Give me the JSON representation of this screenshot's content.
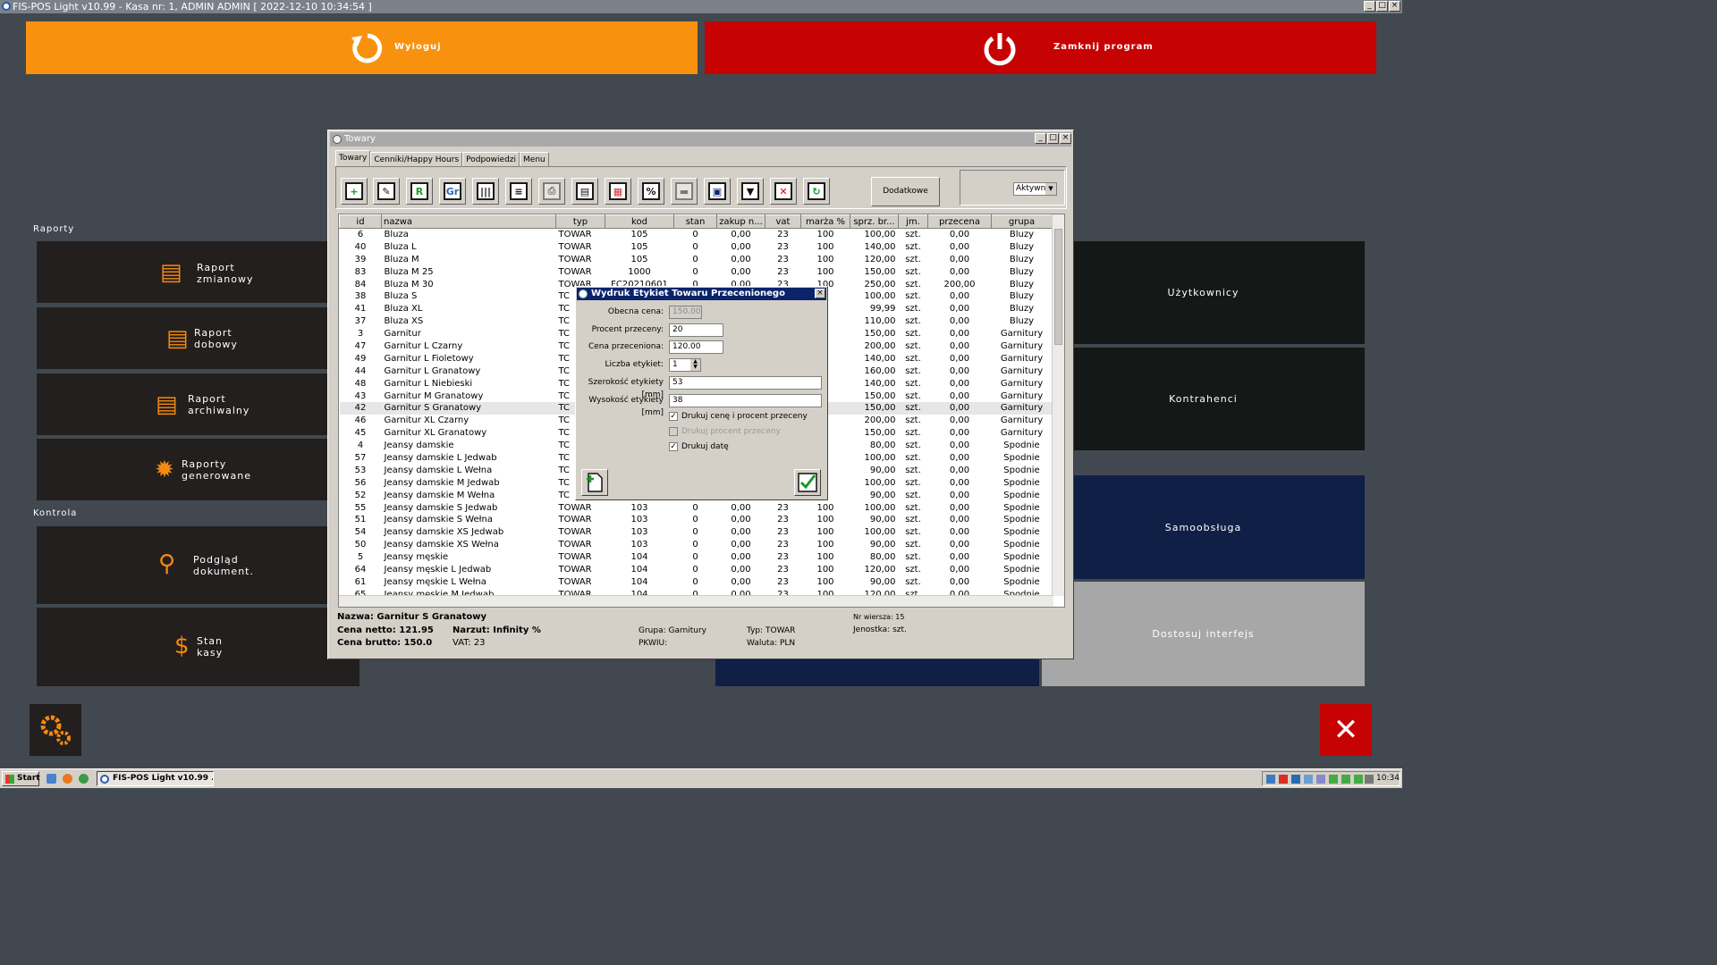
{
  "app": {
    "title": "FIS-POS Light v10.99 - Kasa nr: 1, ADMIN ADMIN [ 2022-12-10 10:34:54 ]"
  },
  "top_buttons": {
    "logout_label": "Wyloguj",
    "close_label": "Zamknij program"
  },
  "colors": {
    "logout": "#f8920e",
    "close": "#c60202",
    "tile_dark": "#231f1e",
    "samoobsluga": "#0f1f45"
  },
  "left_panel": {
    "section_reports": "Raporty",
    "section_control": "Kontrola",
    "tiles": [
      {
        "line1": "Raport",
        "line2": "zmianowy",
        "icon": "report-icon"
      },
      {
        "line1": "Raport",
        "line2": "dobowy",
        "icon": "report-icon"
      },
      {
        "line1": "Raport",
        "line2": "archiwalny",
        "icon": "report-icon"
      },
      {
        "line1": "Raporty",
        "line2": "generowane",
        "icon": "gear-icon"
      },
      {
        "line1": "Podgląd",
        "line2": "dokument.",
        "icon": "magnifier-icon"
      },
      {
        "line1": "Stan",
        "line2": "kasy",
        "icon": "dollar-icon"
      }
    ]
  },
  "right_panel": {
    "users": "Użytkownicy",
    "contractors": "Kontrahenci",
    "self_service": "Samoobsługa",
    "customize": "Dostosuj interfejs"
  },
  "window": {
    "title": "Towary",
    "tabs": [
      "Towary",
      "Cenniki/Happy Hours",
      "Podpowiedzi",
      "Menu"
    ],
    "extra_options": "Dodatkowe opcje",
    "filter_value": "Aktywne",
    "toolbar_icons": [
      "new-item-icon",
      "edit-icon",
      "r-icon",
      "gr-icon",
      "barcode-icon",
      "list-settings-icon",
      "printer-icon",
      "label-print-icon",
      "goods-icon",
      "percent-icon",
      "truck-icon",
      "save-icon",
      "filter-icon",
      "clear-filter-icon",
      "refresh-icon"
    ],
    "columns": [
      "id",
      "nazwa",
      "typ",
      "kod",
      "stan",
      "zakup n...",
      "vat",
      "marża %",
      "sprz. br...",
      "jm.",
      "przecena",
      "grupa"
    ],
    "rows": [
      [
        "6",
        "Bluza",
        "TOWAR",
        "105",
        "0",
        "0,00",
        "23",
        "100",
        "100,00",
        "szt.",
        "0,00",
        "Bluzy"
      ],
      [
        "40",
        "Bluza L",
        "TOWAR",
        "105",
        "0",
        "0,00",
        "23",
        "100",
        "140,00",
        "szt.",
        "0,00",
        "Bluzy"
      ],
      [
        "39",
        "Bluza M",
        "TOWAR",
        "105",
        "0",
        "0,00",
        "23",
        "100",
        "120,00",
        "szt.",
        "0,00",
        "Bluzy"
      ],
      [
        "83",
        "Bluza M 25",
        "TOWAR",
        "1000",
        "0",
        "0,00",
        "23",
        "100",
        "150,00",
        "szt.",
        "0,00",
        "Bluzy"
      ],
      [
        "84",
        "Bluza M 30",
        "TOWAR",
        "FC20210601",
        "0",
        "0,00",
        "23",
        "100",
        "250,00",
        "szt.",
        "200,00",
        "Bluzy"
      ],
      [
        "38",
        "Bluza S",
        "TC",
        "",
        "",
        "",
        "",
        "",
        "100,00",
        "szt.",
        "0,00",
        "Bluzy"
      ],
      [
        "41",
        "Bluza XL",
        "TC",
        "",
        "",
        "",
        "",
        "",
        "99,99",
        "szt.",
        "0,00",
        "Bluzy"
      ],
      [
        "37",
        "Bluza XS",
        "TC",
        "",
        "",
        "",
        "",
        "",
        "110,00",
        "szt.",
        "0,00",
        "Bluzy"
      ],
      [
        "3",
        "Garnitur",
        "TC",
        "",
        "",
        "",
        "",
        "",
        "150,00",
        "szt.",
        "0,00",
        "Garnitury"
      ],
      [
        "47",
        "Garnitur L Czarny",
        "TC",
        "",
        "",
        "",
        "",
        "",
        "200,00",
        "szt.",
        "0,00",
        "Garnitury"
      ],
      [
        "49",
        "Garnitur L Fioletowy",
        "TC",
        "",
        "",
        "",
        "",
        "",
        "140,00",
        "szt.",
        "0,00",
        "Garnitury"
      ],
      [
        "44",
        "Garnitur L Granatowy",
        "TC",
        "",
        "",
        "",
        "",
        "",
        "160,00",
        "szt.",
        "0,00",
        "Garnitury"
      ],
      [
        "48",
        "Garnitur L Niebieski",
        "TC",
        "",
        "",
        "",
        "",
        "",
        "140,00",
        "szt.",
        "0,00",
        "Garnitury"
      ],
      [
        "43",
        "Garnitur M Granatowy",
        "TC",
        "",
        "",
        "",
        "",
        "",
        "150,00",
        "szt.",
        "0,00",
        "Garnitury"
      ],
      [
        "42",
        "Garnitur S Granatowy",
        "TC",
        "",
        "",
        "",
        "",
        "",
        "150,00",
        "szt.",
        "0,00",
        "Garnitury"
      ],
      [
        "46",
        "Garnitur XL Czarny",
        "TC",
        "",
        "",
        "",
        "",
        "",
        "200,00",
        "szt.",
        "0,00",
        "Garnitury"
      ],
      [
        "45",
        "Garnitur XL Granatowy",
        "TC",
        "",
        "",
        "",
        "",
        "",
        "150,00",
        "szt.",
        "0,00",
        "Garnitury"
      ],
      [
        "4",
        "Jeansy damskie",
        "TC",
        "",
        "",
        "",
        "",
        "",
        "80,00",
        "szt.",
        "0,00",
        "Spodnie"
      ],
      [
        "57",
        "Jeansy damskie L Jedwab",
        "TC",
        "",
        "",
        "",
        "",
        "",
        "100,00",
        "szt.",
        "0,00",
        "Spodnie"
      ],
      [
        "53",
        "Jeansy damskie L Wełna",
        "TC",
        "",
        "",
        "",
        "",
        "",
        "90,00",
        "szt.",
        "0,00",
        "Spodnie"
      ],
      [
        "56",
        "Jeansy damskie M Jedwab",
        "TC",
        "",
        "",
        "",
        "",
        "",
        "100,00",
        "szt.",
        "0,00",
        "Spodnie"
      ],
      [
        "52",
        "Jeansy damskie M Wełna",
        "TC",
        "",
        "",
        "",
        "",
        "",
        "90,00",
        "szt.",
        "0,00",
        "Spodnie"
      ],
      [
        "55",
        "Jeansy damskie S Jedwab",
        "TOWAR",
        "103",
        "0",
        "0,00",
        "23",
        "100",
        "100,00",
        "szt.",
        "0,00",
        "Spodnie"
      ],
      [
        "51",
        "Jeansy damskie S Wełna",
        "TOWAR",
        "103",
        "0",
        "0,00",
        "23",
        "100",
        "90,00",
        "szt.",
        "0,00",
        "Spodnie"
      ],
      [
        "54",
        "Jeansy damskie XS Jedwab",
        "TOWAR",
        "103",
        "0",
        "0,00",
        "23",
        "100",
        "100,00",
        "szt.",
        "0,00",
        "Spodnie"
      ],
      [
        "50",
        "Jeansy damskie XS Wełna",
        "TOWAR",
        "103",
        "0",
        "0,00",
        "23",
        "100",
        "90,00",
        "szt.",
        "0,00",
        "Spodnie"
      ],
      [
        "5",
        "Jeansy męskie",
        "TOWAR",
        "104",
        "0",
        "0,00",
        "23",
        "100",
        "80,00",
        "szt.",
        "0,00",
        "Spodnie"
      ],
      [
        "64",
        "Jeansy męskie L Jedwab",
        "TOWAR",
        "104",
        "0",
        "0,00",
        "23",
        "100",
        "120,00",
        "szt.",
        "0,00",
        "Spodnie"
      ],
      [
        "61",
        "Jeansy męskie L Wełna",
        "TOWAR",
        "104",
        "0",
        "0,00",
        "23",
        "100",
        "90,00",
        "szt.",
        "0,00",
        "Spodnie"
      ],
      [
        "65",
        "Jeansy męskie M Jedwab",
        "TOWAR",
        "104",
        "0",
        "0,00",
        "23",
        "100",
        "120,00",
        "szt.",
        "0,00",
        "Spodnie"
      ]
    ],
    "selected_row": 14,
    "status": {
      "name": "Nazwa: Garnitur S Granatowy",
      "net": "Cena netto: 121.95",
      "gross": "Cena brutto: 150.0",
      "markup": "Narzut: Infinity %",
      "vat": "VAT: 23",
      "group": "Grupa: Garnitury",
      "pkwiu": "PKWIU:",
      "type": "Typ: TOWAR",
      "currency": "Waluta: PLN",
      "row_no": "Nr wiersza: 15",
      "unit": "Jenostka: szt."
    }
  },
  "dialog": {
    "title": "Wydruk Etykiet Towaru Przecenionego",
    "current_price_label": "Obecna cena:",
    "current_price": "150.00",
    "discount_pct_label": "Procent przeceny:",
    "discount_pct": "20",
    "discounted_price_label": "Cena przeceniona:",
    "discounted_price": "120.00",
    "label_count_label": "Liczba etykiet:",
    "label_count": "1",
    "label_width_label": "Szerokość etykiety [mm]",
    "label_width": "53",
    "label_height_label": "Wysokość etykiety [mm]",
    "label_height": "38",
    "chk_print_price": "Drukuj cenę i procent przeceny",
    "chk_print_pct": "Drukuj procent przeceny",
    "chk_print_date": "Drukuj datę"
  },
  "taskbar": {
    "start": "Start",
    "task": "FIS-POS Light v10.99 ...",
    "clock": "10:34"
  }
}
